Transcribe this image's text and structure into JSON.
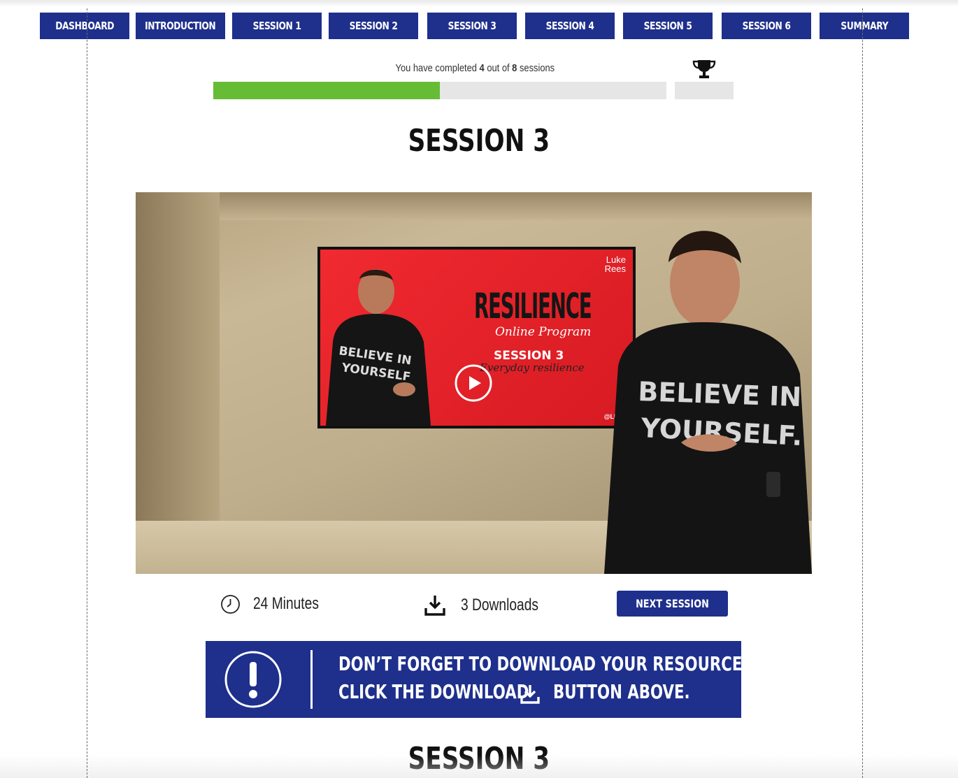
{
  "nav": {
    "items": [
      {
        "label": "DASHBOARD"
      },
      {
        "label": "INTRODUCTION"
      },
      {
        "label": "SESSION 1"
      },
      {
        "label": "SESSION 2"
      },
      {
        "label": "SESSION 3"
      },
      {
        "label": "SESSION 4"
      },
      {
        "label": "SESSION 5"
      },
      {
        "label": "SESSION 6"
      },
      {
        "label": "SUMMARY"
      }
    ],
    "color": "#1e2f8c"
  },
  "progress": {
    "prefix": "You have completed",
    "completed": "4",
    "middle": "out of",
    "total": "8",
    "suffix": "sessions",
    "fraction": 0.5,
    "fill_color": "#66bc35",
    "icon": "trophy-icon"
  },
  "page": {
    "title": "SESSION 3",
    "bottom_title": "SESSION 3"
  },
  "video": {
    "slide": {
      "brand_line1": "Luke",
      "brand_line2": "Rees",
      "heading": "RESILIENCE",
      "subheading": "Online Program",
      "session": "SESSION 3",
      "tagline": "Everyday resilience",
      "handle": "@LUKE",
      "shirt_line1": "BELIEVE IN",
      "shirt_line2": "YOURSELF"
    },
    "presenter_shirt_line1": "BELIEVE IN",
    "presenter_shirt_line2": "YOURSELF.",
    "play_icon": "play-icon"
  },
  "meta": {
    "duration": "24 Minutes",
    "downloads": "3 Downloads",
    "next_label": "NEXT SESSION"
  },
  "banner": {
    "line1": "DON’T FORGET TO DOWNLOAD YOUR RESOURCES.",
    "line2_before": "CLICK THE DOWNLOAD",
    "line2_after": "BUTTON ABOVE.",
    "icon": "exclamation-icon"
  }
}
